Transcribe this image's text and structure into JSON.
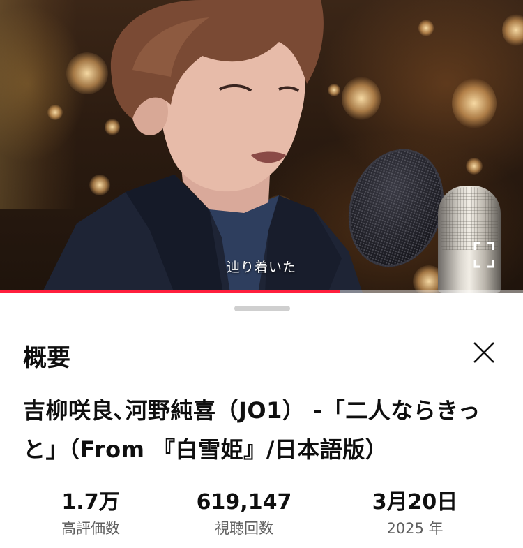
{
  "video": {
    "subtitle": "辿り着いた",
    "progress_fraction": 0.65,
    "progress_color": "#ff1f3d"
  },
  "sheet": {
    "title": "概要",
    "close_icon": "close-icon",
    "video_title": "吉柳咲良､河野純喜（JO1） -「二人ならきっと」（From 『白雪姫』/日本語版）",
    "stats": [
      {
        "value": "1.7万",
        "label": "高評価数"
      },
      {
        "value": "619,147",
        "label": "視聴回数"
      },
      {
        "value": "3月20日",
        "label": "2025 年"
      }
    ]
  }
}
